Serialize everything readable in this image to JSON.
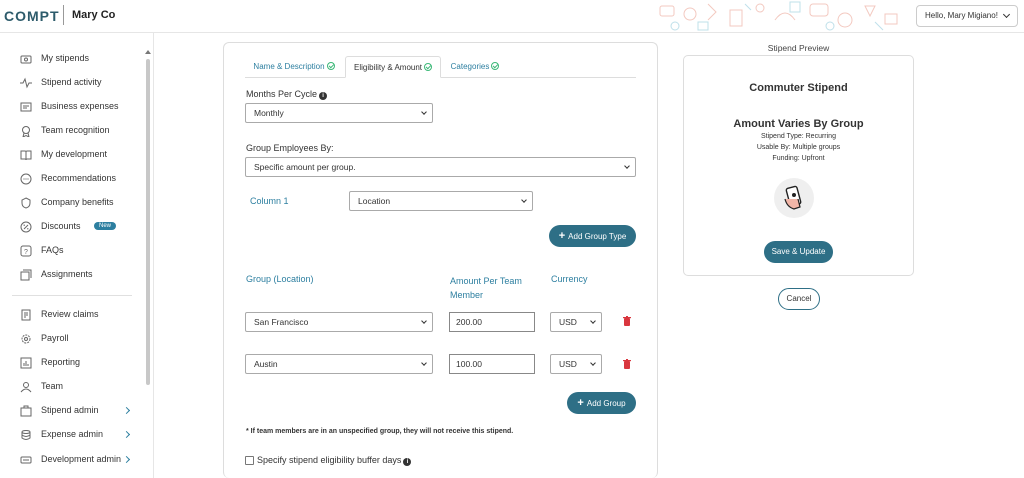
{
  "header": {
    "logo": "COMPT",
    "company": "Mary Co",
    "user_menu": "Hello, Mary Migiano!"
  },
  "sidebar": {
    "items": [
      {
        "label": "My stipends",
        "icon": "stipend-icon"
      },
      {
        "label": "Stipend activity",
        "icon": "activity-icon"
      },
      {
        "label": "Business expenses",
        "icon": "expenses-icon"
      },
      {
        "label": "Team recognition",
        "icon": "recognition-icon"
      },
      {
        "label": "My development",
        "icon": "book-icon"
      },
      {
        "label": "Recommendations",
        "icon": "chat-icon"
      },
      {
        "label": "Company benefits",
        "icon": "benefits-icon"
      },
      {
        "label": "Discounts",
        "icon": "discount-icon",
        "badge": "New"
      },
      {
        "label": "FAQs",
        "icon": "faq-icon"
      },
      {
        "label": "Assignments",
        "icon": "assignments-icon"
      },
      {
        "label": "Review claims",
        "icon": "claims-icon"
      },
      {
        "label": "Payroll",
        "icon": "payroll-icon"
      },
      {
        "label": "Reporting",
        "icon": "reporting-icon"
      },
      {
        "label": "Team",
        "icon": "team-icon"
      },
      {
        "label": "Stipend admin",
        "icon": "briefcase-icon"
      },
      {
        "label": "Expense admin",
        "icon": "stack-icon"
      },
      {
        "label": "Development admin",
        "icon": "dev-admin-icon"
      }
    ]
  },
  "tabs": [
    {
      "label": "Name & Description"
    },
    {
      "label": "Eligibility & Amount"
    },
    {
      "label": "Categories"
    }
  ],
  "form": {
    "months_per_cycle_label": "Months Per Cycle",
    "months_per_cycle_value": "Monthly",
    "group_employees_label": "Group Employees By:",
    "group_employees_value": "Specific amount per group.",
    "column_label": "Column 1",
    "column_value": "Location",
    "add_group_type": "Add Group Type",
    "col_group": "Group (Location)",
    "col_amount_line1": "Amount Per Team",
    "col_amount_line2": "Member",
    "col_currency": "Currency",
    "rows": [
      {
        "group": "San Francisco",
        "amount": "200.00",
        "currency": "USD"
      },
      {
        "group": "Austin",
        "amount": "100.00",
        "currency": "USD"
      }
    ],
    "add_group": "Add Group",
    "note": "* If team members are in an unspecified group, they will not receive this stipend.",
    "buffer_days_label": "Specify stipend eligibility buffer days"
  },
  "preview": {
    "title": "Stipend Preview",
    "name": "Commuter Stipend",
    "amount": "Amount Varies By Group",
    "type": "Stipend Type: Recurring",
    "usable_by": "Usable By: Multiple groups",
    "funding": "Funding: Upfront",
    "save_button": "Save & Update",
    "cancel_button": "Cancel"
  },
  "colors": {
    "accent": "#2e6f86",
    "link": "#2d7fa0",
    "check": "#3cb878",
    "danger": "#d9363e"
  }
}
